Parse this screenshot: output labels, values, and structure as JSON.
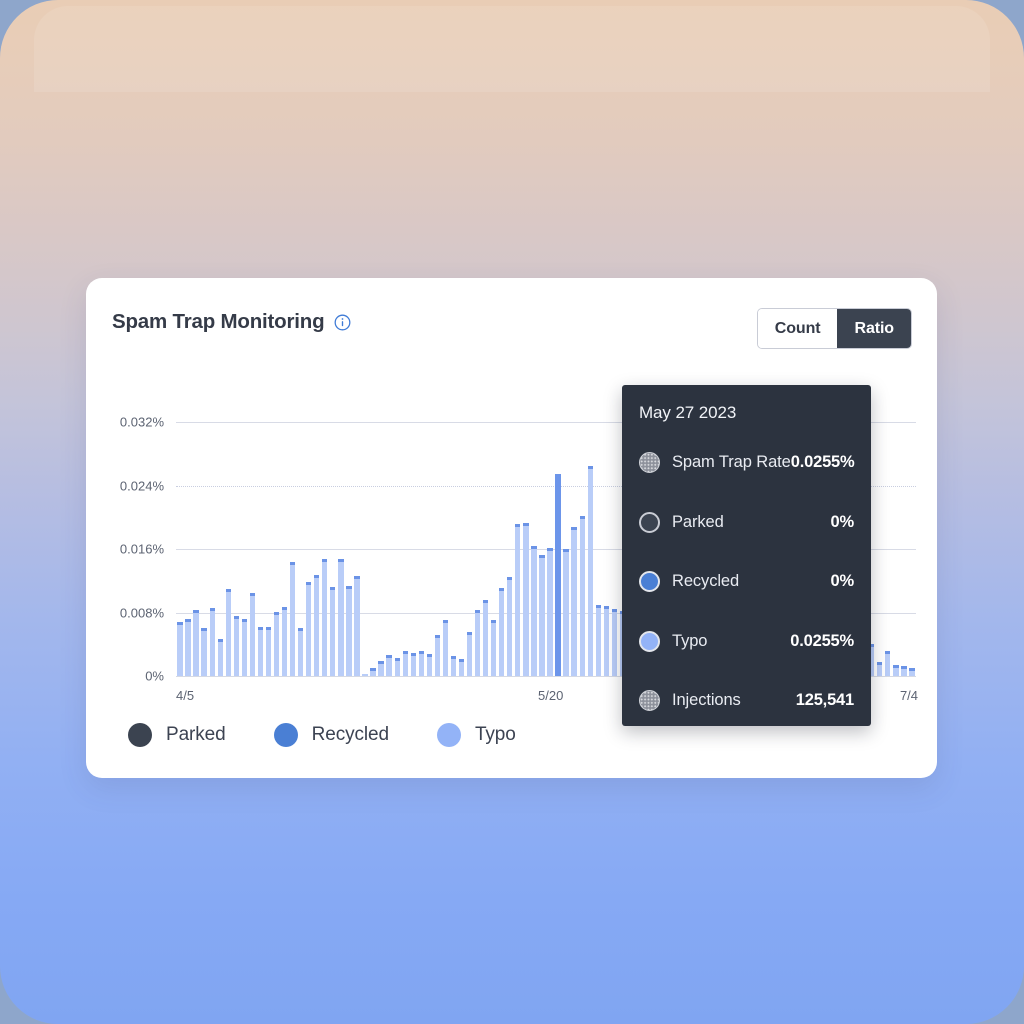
{
  "card": {
    "title": "Spam Trap Monitoring",
    "info_icon": "info-circle-icon"
  },
  "toggle": {
    "count_label": "Count",
    "ratio_label": "Ratio",
    "selected": "Ratio"
  },
  "legend": [
    {
      "label": "Parked",
      "color": "#3b4350"
    },
    {
      "label": "Recycled",
      "color": "#4a7fd4"
    },
    {
      "label": "Typo",
      "color": "#93b3f7"
    }
  ],
  "tooltip": {
    "date": "May 27 2023",
    "rows": [
      {
        "label": "Spam Trap Rate",
        "value": "0.0255%",
        "color": "#8d919b",
        "pattern": "dotted"
      },
      {
        "label": "Parked",
        "value": "0%",
        "color": "#3b4350",
        "pattern": "outline"
      },
      {
        "label": "Recycled",
        "value": "0%",
        "color": "#4a7fd4",
        "pattern": "solid"
      },
      {
        "label": "Typo",
        "value": "0.0255%",
        "color": "#93b3f7",
        "pattern": "solid"
      },
      {
        "label": "Injections",
        "value": "125,541",
        "color": "#8d919b",
        "pattern": "dotted"
      }
    ]
  },
  "chart_data": {
    "type": "bar",
    "title": "Spam Trap Monitoring",
    "xlabel": "",
    "ylabel": "",
    "ylim": [
      0,
      0.036
    ],
    "grid": true,
    "legend_position": "bottom-left",
    "ytick_labels": [
      "0%",
      "0.008%",
      "0.016%",
      "0.024%",
      "0.032%"
    ],
    "ytick_values": [
      0,
      0.008,
      0.016,
      0.024,
      0.032
    ],
    "xtick_labels": [
      "4/5",
      "5/20",
      "7/4"
    ],
    "xtick_indices": [
      1,
      46,
      91
    ],
    "series": [
      {
        "name": "Typo",
        "color": "#b9cdf8",
        "values": [
          0.0068,
          0.0072,
          0.0083,
          0.006,
          0.0086,
          0.0047,
          0.011,
          0.0076,
          0.0072,
          0.0104,
          0.0062,
          0.0062,
          0.0081,
          0.0087,
          0.0144,
          0.006,
          0.0118,
          0.0127,
          0.0148,
          0.0112,
          0.0148,
          0.0114,
          0.0126,
          0.0002,
          0.001,
          0.0019,
          0.0026,
          0.0023,
          0.0031,
          0.0029,
          0.0032,
          0.0028,
          0.0052,
          0.0071,
          0.0025,
          0.0022,
          0.0056,
          0.0083,
          0.0096,
          0.007,
          0.0111,
          0.0125,
          0.0191,
          0.0193,
          0.0164,
          0.0153,
          0.0161,
          0.0255,
          0.016,
          0.0188,
          0.0201,
          0.0265,
          0.009,
          0.0088,
          0.0085,
          0.0082,
          0.008,
          0.0078,
          0.0076,
          0.0074,
          0.0072,
          0.007,
          0.0068,
          0.0066,
          0.0064,
          0.0062,
          0.006,
          0.0058,
          0.0056,
          0.0054,
          0.0052,
          0.005,
          0.0048,
          0.0046,
          0.0044,
          0.0042,
          0.004,
          0.0038,
          0.0036,
          0.0034,
          0.0032,
          0.003,
          0.0028,
          0.0026,
          0.0024,
          0.0022,
          0.004,
          0.0018,
          0.0031,
          0.0014,
          0.0012,
          0.001
        ]
      }
    ],
    "highlighted_index": 47,
    "highlight_color": "#6c95ea"
  }
}
